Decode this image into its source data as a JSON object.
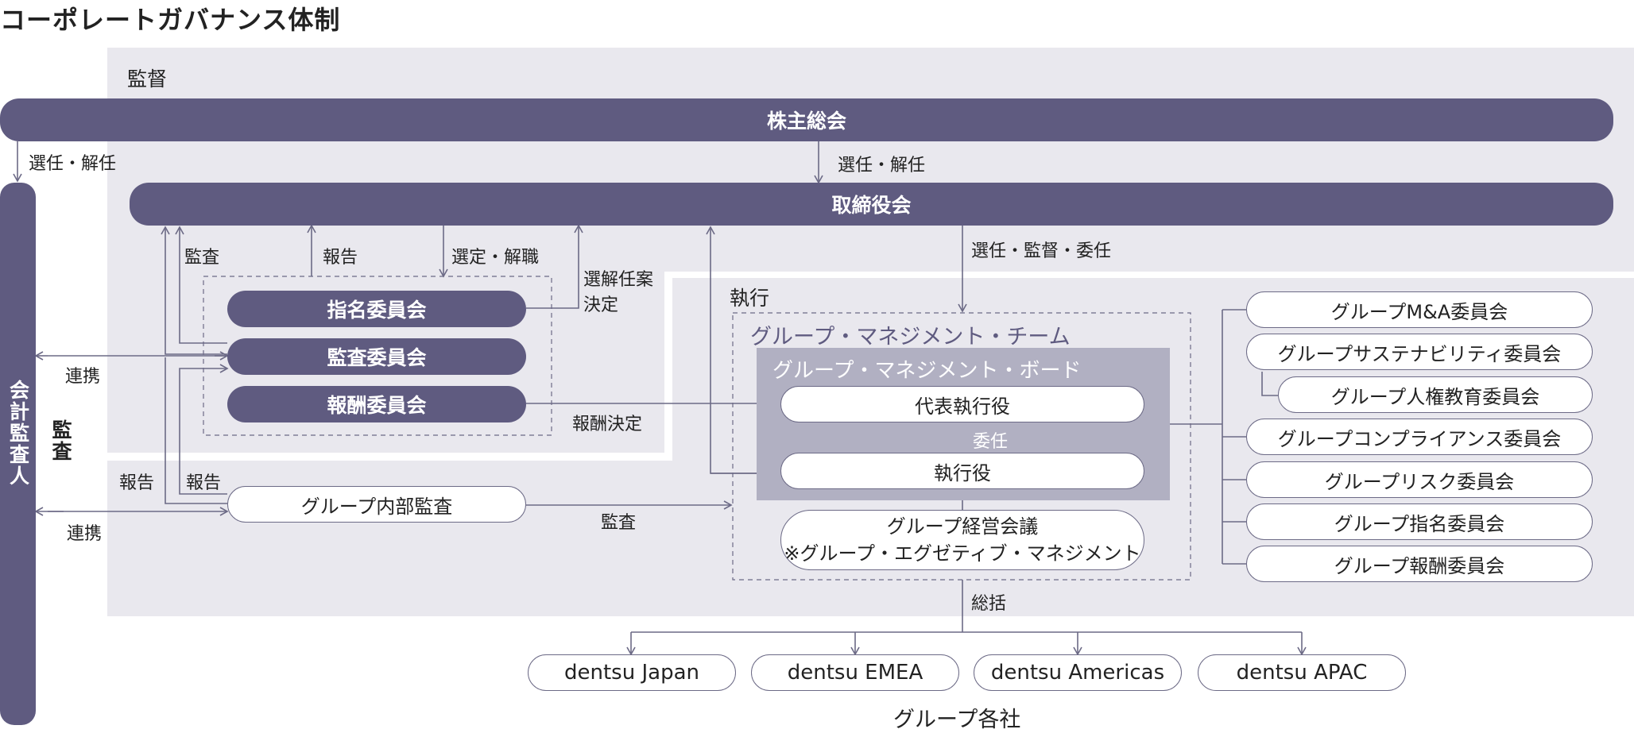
{
  "title": "コーポレートガバナンス体制",
  "sections": {
    "supervision": "監督",
    "execution": "執行"
  },
  "bodies": {
    "shareholders": "株主総会",
    "board": "取締役会",
    "auditor": "会計監査人",
    "audit_side": "監査"
  },
  "committees": {
    "nomination": "指名委員会",
    "audit": "監査委員会",
    "compensation": "報酬委員会"
  },
  "internal_audit": "グループ内部監査",
  "management_team": "グループ・マネジメント・チーム",
  "management_board": "グループ・マネジメント・ボード",
  "executives": {
    "ceo": "代表執行役",
    "delegation": "委任",
    "officer": "執行役"
  },
  "executive_meeting": {
    "line1": "グループ経営会議",
    "line2": "※グループ・エグゼティブ・マネジメント"
  },
  "right_committees": [
    "グループM&A委員会",
    "グループサステナビリティ委員会",
    "グループ人権教育委員会",
    "グループコンプライアンス委員会",
    "グループリスク委員会",
    "グループ指名委員会",
    "グループ報酬委員会"
  ],
  "regions": [
    "dentsu Japan",
    "dentsu EMEA",
    "dentsu Americas",
    "dentsu APAC"
  ],
  "group_companies": "グループ各社",
  "labels": {
    "elect_dismiss_left": "選任・解任",
    "elect_dismiss_center": "選任・解任",
    "audit_label": "監査",
    "report_label": "報告",
    "select_dismiss": "選定・解職",
    "proposal_line1": "選解任案",
    "proposal_line2": "決定",
    "elect_supervise_delegate": "選任・監督・委任",
    "cooperation_top": "連携",
    "cooperation_bottom": "連携",
    "compensation_decision": "報酬決定",
    "report_left": "報告",
    "report_right": "報告",
    "audit_bottom": "監査",
    "oversight": "総括"
  },
  "colors": {
    "dark_purple": "#5f5b80",
    "panel_gray": "#e9e8ee",
    "board_gray": "#b1b0c2",
    "line": "#6c6a86"
  }
}
